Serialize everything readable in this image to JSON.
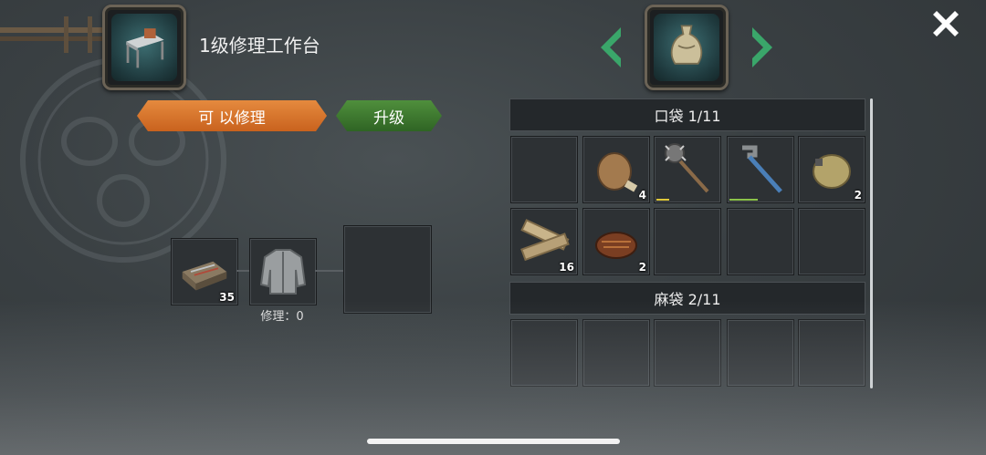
{
  "header": {
    "title": "1级修理工作台",
    "station_icon": "workbench-icon",
    "selected_container_icon": "sack-icon"
  },
  "buttons": {
    "repair_label": "可 以修理",
    "upgrade_label": "升级"
  },
  "repair_panel": {
    "material": {
      "icon": "toolbox-icon",
      "count": "35"
    },
    "target": {
      "icon": "jacket-icon",
      "label": "修理：0"
    },
    "output": {
      "icon": ""
    }
  },
  "pocket": {
    "title": "口袋 1/11",
    "slots": [
      {
        "icon": "",
        "count": ""
      },
      {
        "icon": "flask-icon",
        "count": "4"
      },
      {
        "icon": "spiked-club-icon",
        "count": "",
        "durability": 0.2,
        "bar_color": "#e0c93a"
      },
      {
        "icon": "pipe-wrench-icon",
        "count": "",
        "durability": 0.45,
        "bar_color": "#8bc34a"
      },
      {
        "icon": "water-canteen-icon",
        "count": "2"
      },
      {
        "icon": "wood-planks-icon",
        "count": "16"
      },
      {
        "icon": "cooked-meat-icon",
        "count": "2"
      },
      {
        "icon": "",
        "count": ""
      },
      {
        "icon": "",
        "count": ""
      },
      {
        "icon": "",
        "count": ""
      }
    ]
  },
  "sack": {
    "title": "麻袋 2/11",
    "slots": [
      {
        "icon": ""
      },
      {
        "icon": ""
      },
      {
        "icon": ""
      },
      {
        "icon": ""
      },
      {
        "icon": ""
      }
    ]
  }
}
